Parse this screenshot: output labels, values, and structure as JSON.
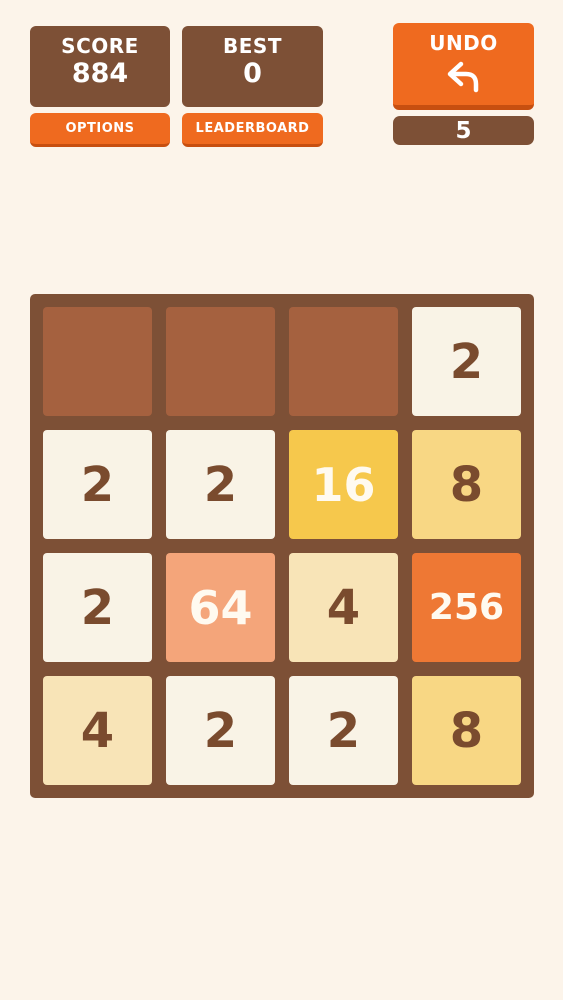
{
  "score": {
    "label": "SCORE",
    "value": "884"
  },
  "best": {
    "label": "BEST",
    "value": "0"
  },
  "buttons": {
    "options": "OPTIONS",
    "leaderboard": "LEADERBOARD",
    "undo": "UNDO",
    "undo_icon": "undo-arrow-icon"
  },
  "undo_count": "5",
  "board": {
    "size": 4,
    "rows": [
      [
        "",
        "",
        "",
        "2"
      ],
      [
        "2",
        "2",
        "16",
        "8"
      ],
      [
        "2",
        "64",
        "4",
        "256"
      ],
      [
        "4",
        "2",
        "2",
        "8"
      ]
    ]
  },
  "colors": {
    "background": "#fcf4ea",
    "panel": "#7d5036",
    "accent": "#ef6a1f",
    "empty_cell": "#a5613f"
  }
}
